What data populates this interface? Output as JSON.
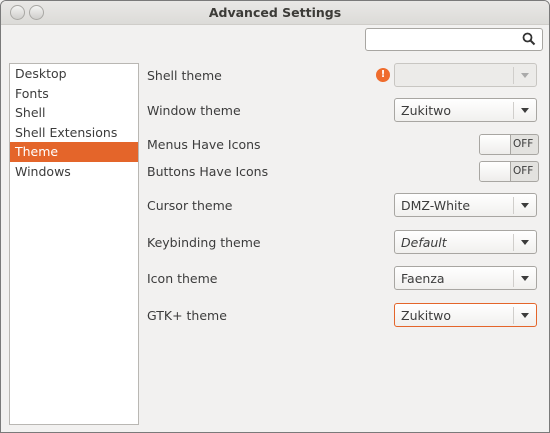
{
  "window": {
    "title": "Advanced Settings"
  },
  "search": {
    "placeholder": ""
  },
  "sidebar": {
    "items": [
      {
        "label": "Desktop",
        "active": false
      },
      {
        "label": "Fonts",
        "active": false
      },
      {
        "label": "Shell",
        "active": false
      },
      {
        "label": "Shell Extensions",
        "active": false
      },
      {
        "label": "Theme",
        "active": true
      },
      {
        "label": "Windows",
        "active": false
      }
    ]
  },
  "settings": {
    "shell_theme": {
      "label": "Shell theme",
      "value": "",
      "warning_glyph": "!"
    },
    "window_theme": {
      "label": "Window theme",
      "value": "Zukitwo"
    },
    "menus_have_icons": {
      "label": "Menus Have Icons",
      "state": "OFF"
    },
    "buttons_have_icons": {
      "label": "Buttons Have Icons",
      "state": "OFF"
    },
    "cursor_theme": {
      "label": "Cursor theme",
      "value": "DMZ-White"
    },
    "keybinding_theme": {
      "label": "Keybinding theme",
      "value": "Default"
    },
    "icon_theme": {
      "label": "Icon theme",
      "value": "Faenza"
    },
    "gtk_theme": {
      "label": "GTK+ theme",
      "value": "Zukitwo"
    }
  },
  "colors": {
    "accent": "#e4652a",
    "warning": "#ef6c2d"
  }
}
